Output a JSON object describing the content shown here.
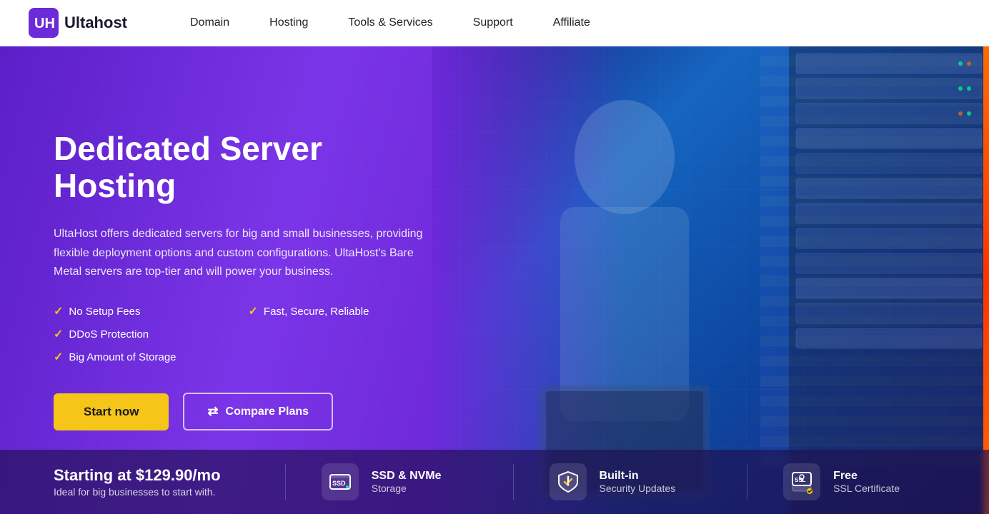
{
  "navbar": {
    "logo_text": "Ultahost",
    "nav_items": [
      {
        "label": "Domain",
        "id": "domain"
      },
      {
        "label": "Hosting",
        "id": "hosting"
      },
      {
        "label": "Tools & Services",
        "id": "tools"
      },
      {
        "label": "Support",
        "id": "support"
      },
      {
        "label": "Affiliate",
        "id": "affiliate"
      }
    ]
  },
  "hero": {
    "title": "Dedicated Server Hosting",
    "description": "UltaHost offers dedicated servers for big and small businesses, providing flexible deployment options and custom configurations. UltaHost's Bare Metal servers are top-tier and will power your business.",
    "features": [
      "No Setup Fees",
      "Fast, Secure, Reliable",
      "DDoS Protection",
      "Big Amount of Storage"
    ],
    "btn_start": "Start now",
    "btn_compare": "Compare Plans",
    "price_main": "Starting at $129.90/mo",
    "price_sub": "Ideal for big businesses to start with.",
    "bottom_features": [
      {
        "id": "ssd",
        "icon_label": "ssd-icon",
        "title": "SSD & NVMe",
        "subtitle": "Storage"
      },
      {
        "id": "security",
        "icon_label": "shield-icon",
        "title": "Built-in",
        "subtitle": "Security Updates"
      },
      {
        "id": "ssl",
        "icon_label": "ssl-icon",
        "title": "Free",
        "subtitle": "SSL Certificate"
      }
    ]
  },
  "colors": {
    "accent_yellow": "#f5c518",
    "primary_purple": "#6d28d9",
    "dark_purple": "#3a1a8a"
  }
}
